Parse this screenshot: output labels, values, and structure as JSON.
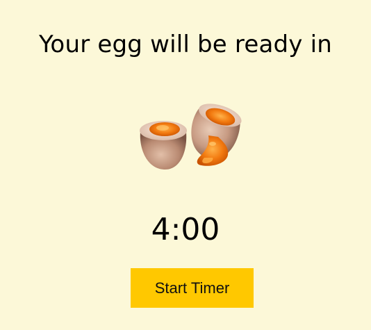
{
  "header": {
    "title": "Your egg will be ready in"
  },
  "illustration": {
    "icon": "soft-boiled-egg-icon"
  },
  "timer": {
    "display": "4:00"
  },
  "controls": {
    "start_label": "Start Timer"
  },
  "colors": {
    "background": "#fcf8d8",
    "button": "#ffc800",
    "yolk": "#f07a0e",
    "shell": "#c99a82"
  }
}
